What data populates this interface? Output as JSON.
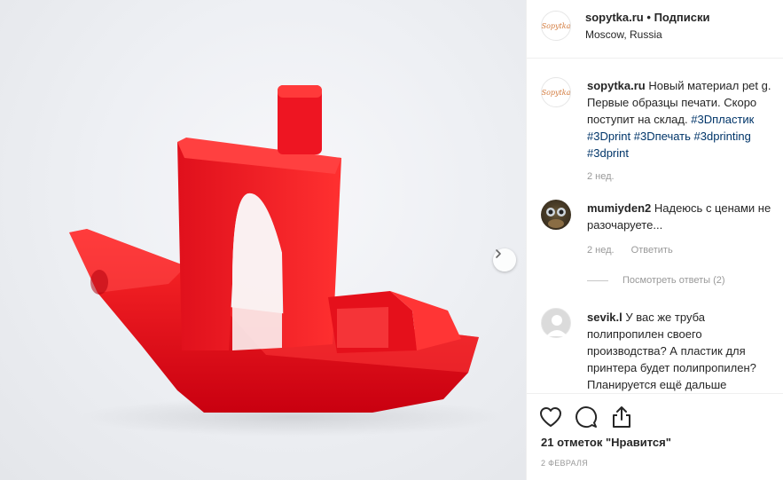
{
  "header": {
    "logo_text": "Sopytka",
    "username": "sopytka.ru",
    "separator": "•",
    "follow_label": "Подписки",
    "location": "Moscow, Russia"
  },
  "caption": {
    "username": "sopytka.ru",
    "text": "Новый материал pet g. Первые образцы печати. Скоро поступит на склад.",
    "hashtags": [
      "#3Dпластик",
      "#3Dprint",
      "#3Dпечать",
      "#3dprinting",
      "#3dprint"
    ],
    "time": "2 нед."
  },
  "comments": [
    {
      "username": "mumiyden2",
      "text": "Надеюсь с ценами не разочаруете...",
      "time": "2 нед.",
      "reply_label": "Ответить",
      "view_replies": "Посмотреть ответы (2)"
    },
    {
      "username": "sevik.l",
      "text": "У вас же труба полипропилен своего производства? А пластик для принтера будет полипропилен? Планируется ещё дальше"
    }
  ],
  "post": {
    "likes": "21 отметок \"Нравится\"",
    "date": "2 ФЕВРАЛЯ"
  },
  "colors": {
    "accent_link": "#003569",
    "muted": "#999999",
    "print_red": "#e8131f"
  },
  "icons": {
    "like": "heart-icon",
    "comment": "comment-bubble-icon",
    "share": "share-icon",
    "next": "chevron-right-icon"
  }
}
